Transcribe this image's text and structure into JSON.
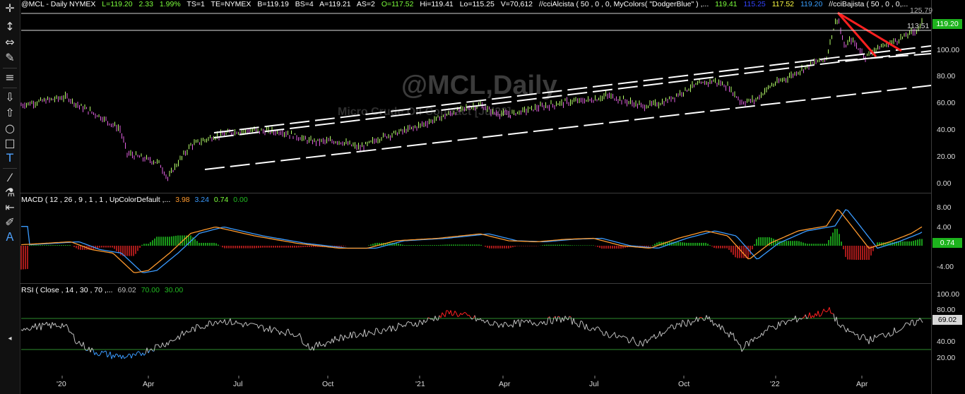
{
  "header": {
    "symbol": "@MCL - Daily  NYMEX",
    "last": "L=119.20",
    "change": "2.33",
    "change_pct": "1.99%",
    "ts": "TS=1",
    "te": "TE=NYMEX",
    "bid": "B=119.19",
    "bs": "BS=4",
    "ask": "A=119.21",
    "as": "AS=2",
    "open": "O=117.52",
    "high": "Hi=119.41",
    "low": "Lo=115.25",
    "volume": "V=70,612",
    "study1": "//cciAlcista ( 50 , 0 , 0, MyColors( \"DodgerBlue\" ) ,...",
    "v1": "119.41",
    "v2": "115.25",
    "v3": "117.52",
    "v4": "119.20",
    "study2": "//cciBajista ( 50 , 0 , 0,..."
  },
  "watermark": {
    "title": "@MCL,Daily",
    "subtitle": "Micro Crude Oil Contract [Jul22]"
  },
  "macd": {
    "label": "MACD ( 12 , 26 , 9 , 1 , 1 , UpColorDefault ,...",
    "v1": "3.98",
    "v2": "3.24",
    "v3": "0.74",
    "v4": "0.00"
  },
  "rsi": {
    "label": "RSI ( Close , 14 , 30 , 70 ,...",
    "v1": "69.02",
    "v2": "70.00",
    "v3": "30.00"
  },
  "price_axis": {
    "ticks": [
      "125.79",
      "113.51",
      "100.00",
      "80.00",
      "60.00",
      "40.00",
      "20.00",
      "0.00"
    ],
    "last_tag": "119.20"
  },
  "macd_axis": {
    "ticks": [
      "8.00",
      "4.00",
      "-4.00"
    ],
    "last_tag": "0.74"
  },
  "rsi_axis": {
    "ticks": [
      "100.00",
      "80.00",
      "40.00",
      "20.00"
    ],
    "last_tag": "69.02"
  },
  "dates": [
    "'20",
    "Apr",
    "Jul",
    "Oct",
    "'21",
    "Apr",
    "Jul",
    "Oct",
    "'22",
    "Apr"
  ],
  "colors": {
    "up": "#b6ff6a",
    "down": "#e060e0",
    "macd_line": "#ff9a2e",
    "signal_line": "#3a9bff",
    "hist_up": "#22cc22",
    "hist_down": "#dd2222",
    "rsi": "#bdbdbd",
    "rsi_ob": "#ff2020",
    "rsi_os": "#3a9bff"
  },
  "toolbar": {
    "icons": [
      "crosshair-icon",
      "vertical-resize-icon",
      "horizontal-resize-icon",
      "pencil-icon",
      "hamburger-icon",
      "arrow-down-icon",
      "arrow-up-icon",
      "circle-icon",
      "square-icon",
      "text-icon",
      "line-icon",
      "paint-icon",
      "tab-icon",
      "highlighter-icon",
      "label-icon"
    ]
  }
}
